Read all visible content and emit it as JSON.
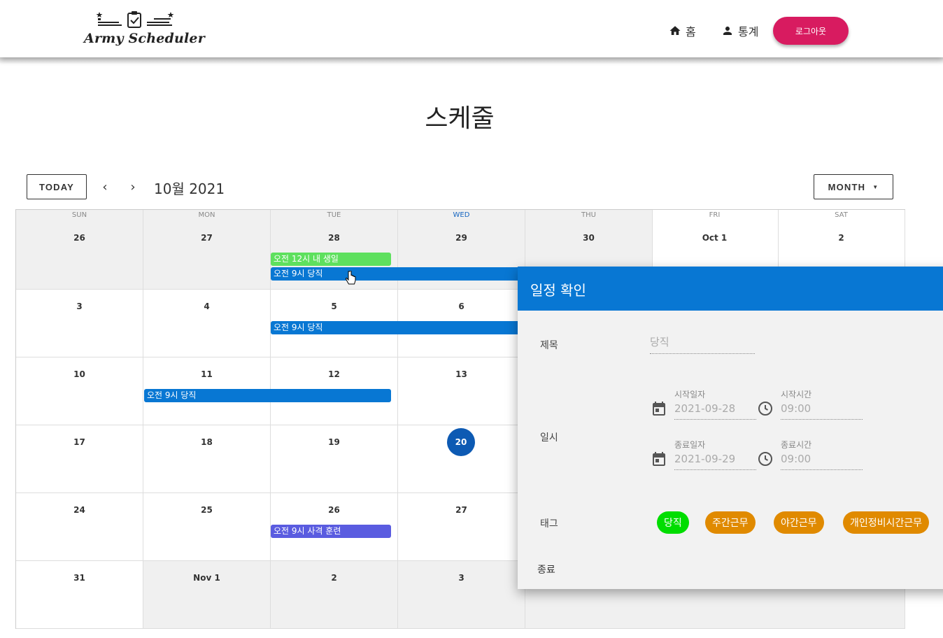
{
  "header": {
    "logo_text": "Army Scheduler",
    "nav": [
      {
        "label": "홈",
        "icon": "home-icon"
      },
      {
        "label": "통계",
        "icon": "person-icon"
      }
    ],
    "logout_label": "로그아웃",
    "logout_color": "#d81b60"
  },
  "page": {
    "title": "스케줄"
  },
  "toolbar": {
    "today_label": "TODAY",
    "prev_icon": "‹",
    "next_icon": "›",
    "month_title": "10월 2021",
    "view_label": "MONTH"
  },
  "calendar": {
    "weekdays": [
      "SUN",
      "MON",
      "TUE",
      "WED",
      "THU",
      "FRI",
      "SAT"
    ],
    "current_weekday_index": 3,
    "weeks": [
      [
        "26",
        "27",
        "28",
        "29",
        "30",
        "Oct 1",
        "2"
      ],
      [
        "3",
        "4",
        "5",
        "6",
        "",
        "",
        ""
      ],
      [
        "10",
        "11",
        "12",
        "13",
        "",
        "",
        ""
      ],
      [
        "17",
        "18",
        "19",
        "20",
        "",
        "",
        ""
      ],
      [
        "24",
        "25",
        "26",
        "27",
        "",
        "",
        ""
      ],
      [
        "31",
        "Nov 1",
        "2",
        "3",
        "",
        "",
        ""
      ]
    ],
    "today": "20",
    "events": [
      {
        "label": "오전 12시 내 생일",
        "color": "#5ee05e"
      },
      {
        "label": "오전 9시 당직",
        "color": "#0877d3"
      },
      {
        "label": "오전 9시 당직",
        "color": "#0877d3"
      },
      {
        "label": "오전 9시 당직",
        "color": "#0877d3"
      },
      {
        "label": "오전 9시 사격 훈련",
        "color": "#5a5ce0"
      }
    ]
  },
  "dialog": {
    "title": "일정 확인",
    "header_color": "#0877d3",
    "title_label": "제목",
    "title_value": "당직",
    "datetime_label": "일시",
    "start_date_label": "시작일자",
    "start_date_value": "2021-09-28",
    "start_time_label": "시작시간",
    "start_time_value": "09:00",
    "end_date_label": "종료일자",
    "end_date_value": "2021-09-29",
    "end_time_label": "종료시간",
    "end_time_value": "09:00",
    "tag_label": "태그",
    "tags": [
      {
        "label": "당직",
        "color": "#00dd00"
      },
      {
        "label": "주간근무",
        "color": "#e08a00"
      },
      {
        "label": "야간근무",
        "color": "#e08a00"
      },
      {
        "label": "개인정비시간근무",
        "color": "#e08a00"
      }
    ],
    "close_label": "종료"
  }
}
